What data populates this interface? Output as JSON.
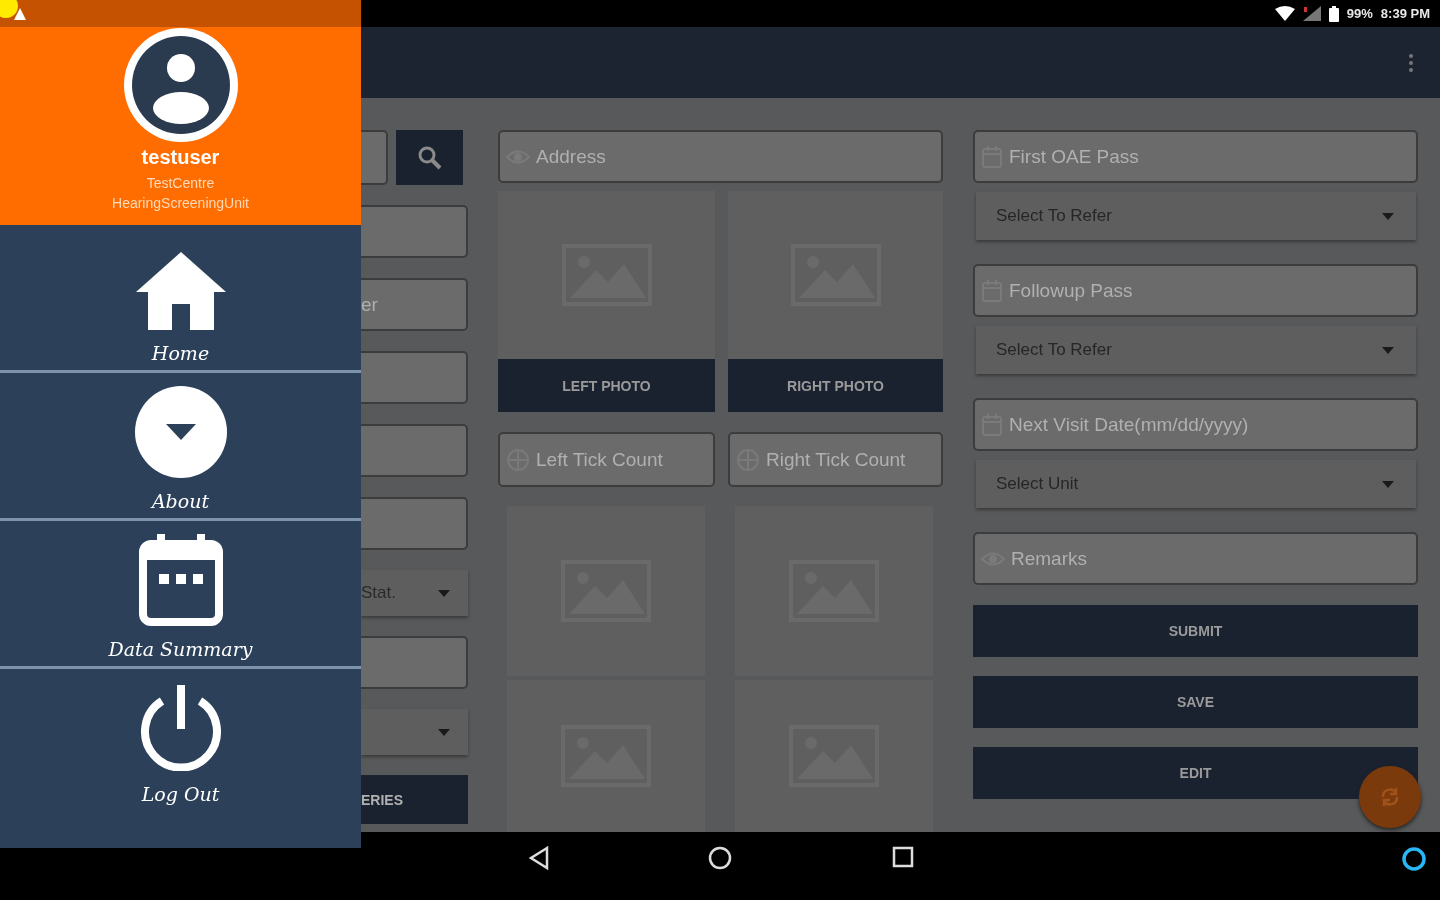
{
  "status_bar": {
    "battery": "99%",
    "time": "8:39 PM"
  },
  "drawer": {
    "user": {
      "name": "testuser",
      "centre": "TestCentre",
      "unit": "HearingScreeningUnit"
    },
    "items": [
      {
        "kind": "home",
        "label": "Home"
      },
      {
        "kind": "about",
        "label": "About"
      },
      {
        "kind": "summary",
        "label": "Data Summary"
      },
      {
        "kind": "logout",
        "label": "Log Out"
      }
    ]
  },
  "left_column": [
    {
      "kind": "search"
    },
    {
      "kind": "field"
    },
    {
      "kind": "field",
      "placeholder": "er"
    },
    {
      "kind": "field"
    },
    {
      "kind": "field"
    },
    {
      "kind": "field"
    },
    {
      "kind": "dropdown",
      "value": "Stat."
    },
    {
      "kind": "field"
    },
    {
      "kind": "dropdown"
    },
    {
      "kind": "button",
      "label": "ERIES"
    }
  ],
  "middle_column": {
    "address": {
      "placeholder": "Address"
    },
    "photos": [
      {
        "label": "LEFT PHOTO"
      },
      {
        "label": "RIGHT PHOTO"
      }
    ],
    "tick_counts": [
      {
        "placeholder": "Left Tick Count"
      },
      {
        "placeholder": "Right Tick Count"
      }
    ],
    "gallery": [
      {
        "kind": "placeholder"
      },
      {
        "kind": "placeholder"
      },
      {
        "kind": "placeholder"
      },
      {
        "kind": "placeholder"
      }
    ]
  },
  "right_column": [
    {
      "kind": "date",
      "placeholder": "First OAE Pass"
    },
    {
      "kind": "dropdown",
      "value": "Select To Refer"
    },
    {
      "kind": "date",
      "placeholder": "Followup Pass"
    },
    {
      "kind": "dropdown",
      "value": "Select To Refer"
    },
    {
      "kind": "date",
      "placeholder": "Next Visit Date(mm/dd/yyyy)"
    },
    {
      "kind": "dropdown",
      "value": "Select Unit"
    },
    {
      "kind": "text",
      "placeholder": "Remarks"
    }
  ],
  "buttons": [
    "SUBMIT",
    "SAVE",
    "EDIT"
  ]
}
